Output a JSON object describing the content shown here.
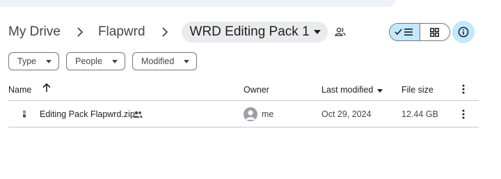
{
  "breadcrumb": {
    "items": [
      "My Drive",
      "Flapwrd"
    ],
    "current": "WRD Editing Pack 1"
  },
  "icons": {
    "separator": "chevron-right-icon",
    "shared_folder": "people-icon",
    "list_view": "checklist-icon",
    "grid_view": "grid-icon",
    "info": "info-icon",
    "file_type": "zip-file-icon"
  },
  "colors": {
    "accent": "#c2e7ff",
    "chip_border": "#747775",
    "divider": "#c7c7c7"
  },
  "filters": [
    "Type",
    "People",
    "Modified"
  ],
  "table": {
    "columns": {
      "name": "Name",
      "owner": "Owner",
      "last_modified": "Last modified",
      "file_size": "File size"
    },
    "rows": [
      {
        "name": "Editing Pack Flapwrd.zip",
        "owner": "me",
        "last_modified": "Oct 29, 2024",
        "file_size": "12.44 GB"
      }
    ]
  }
}
